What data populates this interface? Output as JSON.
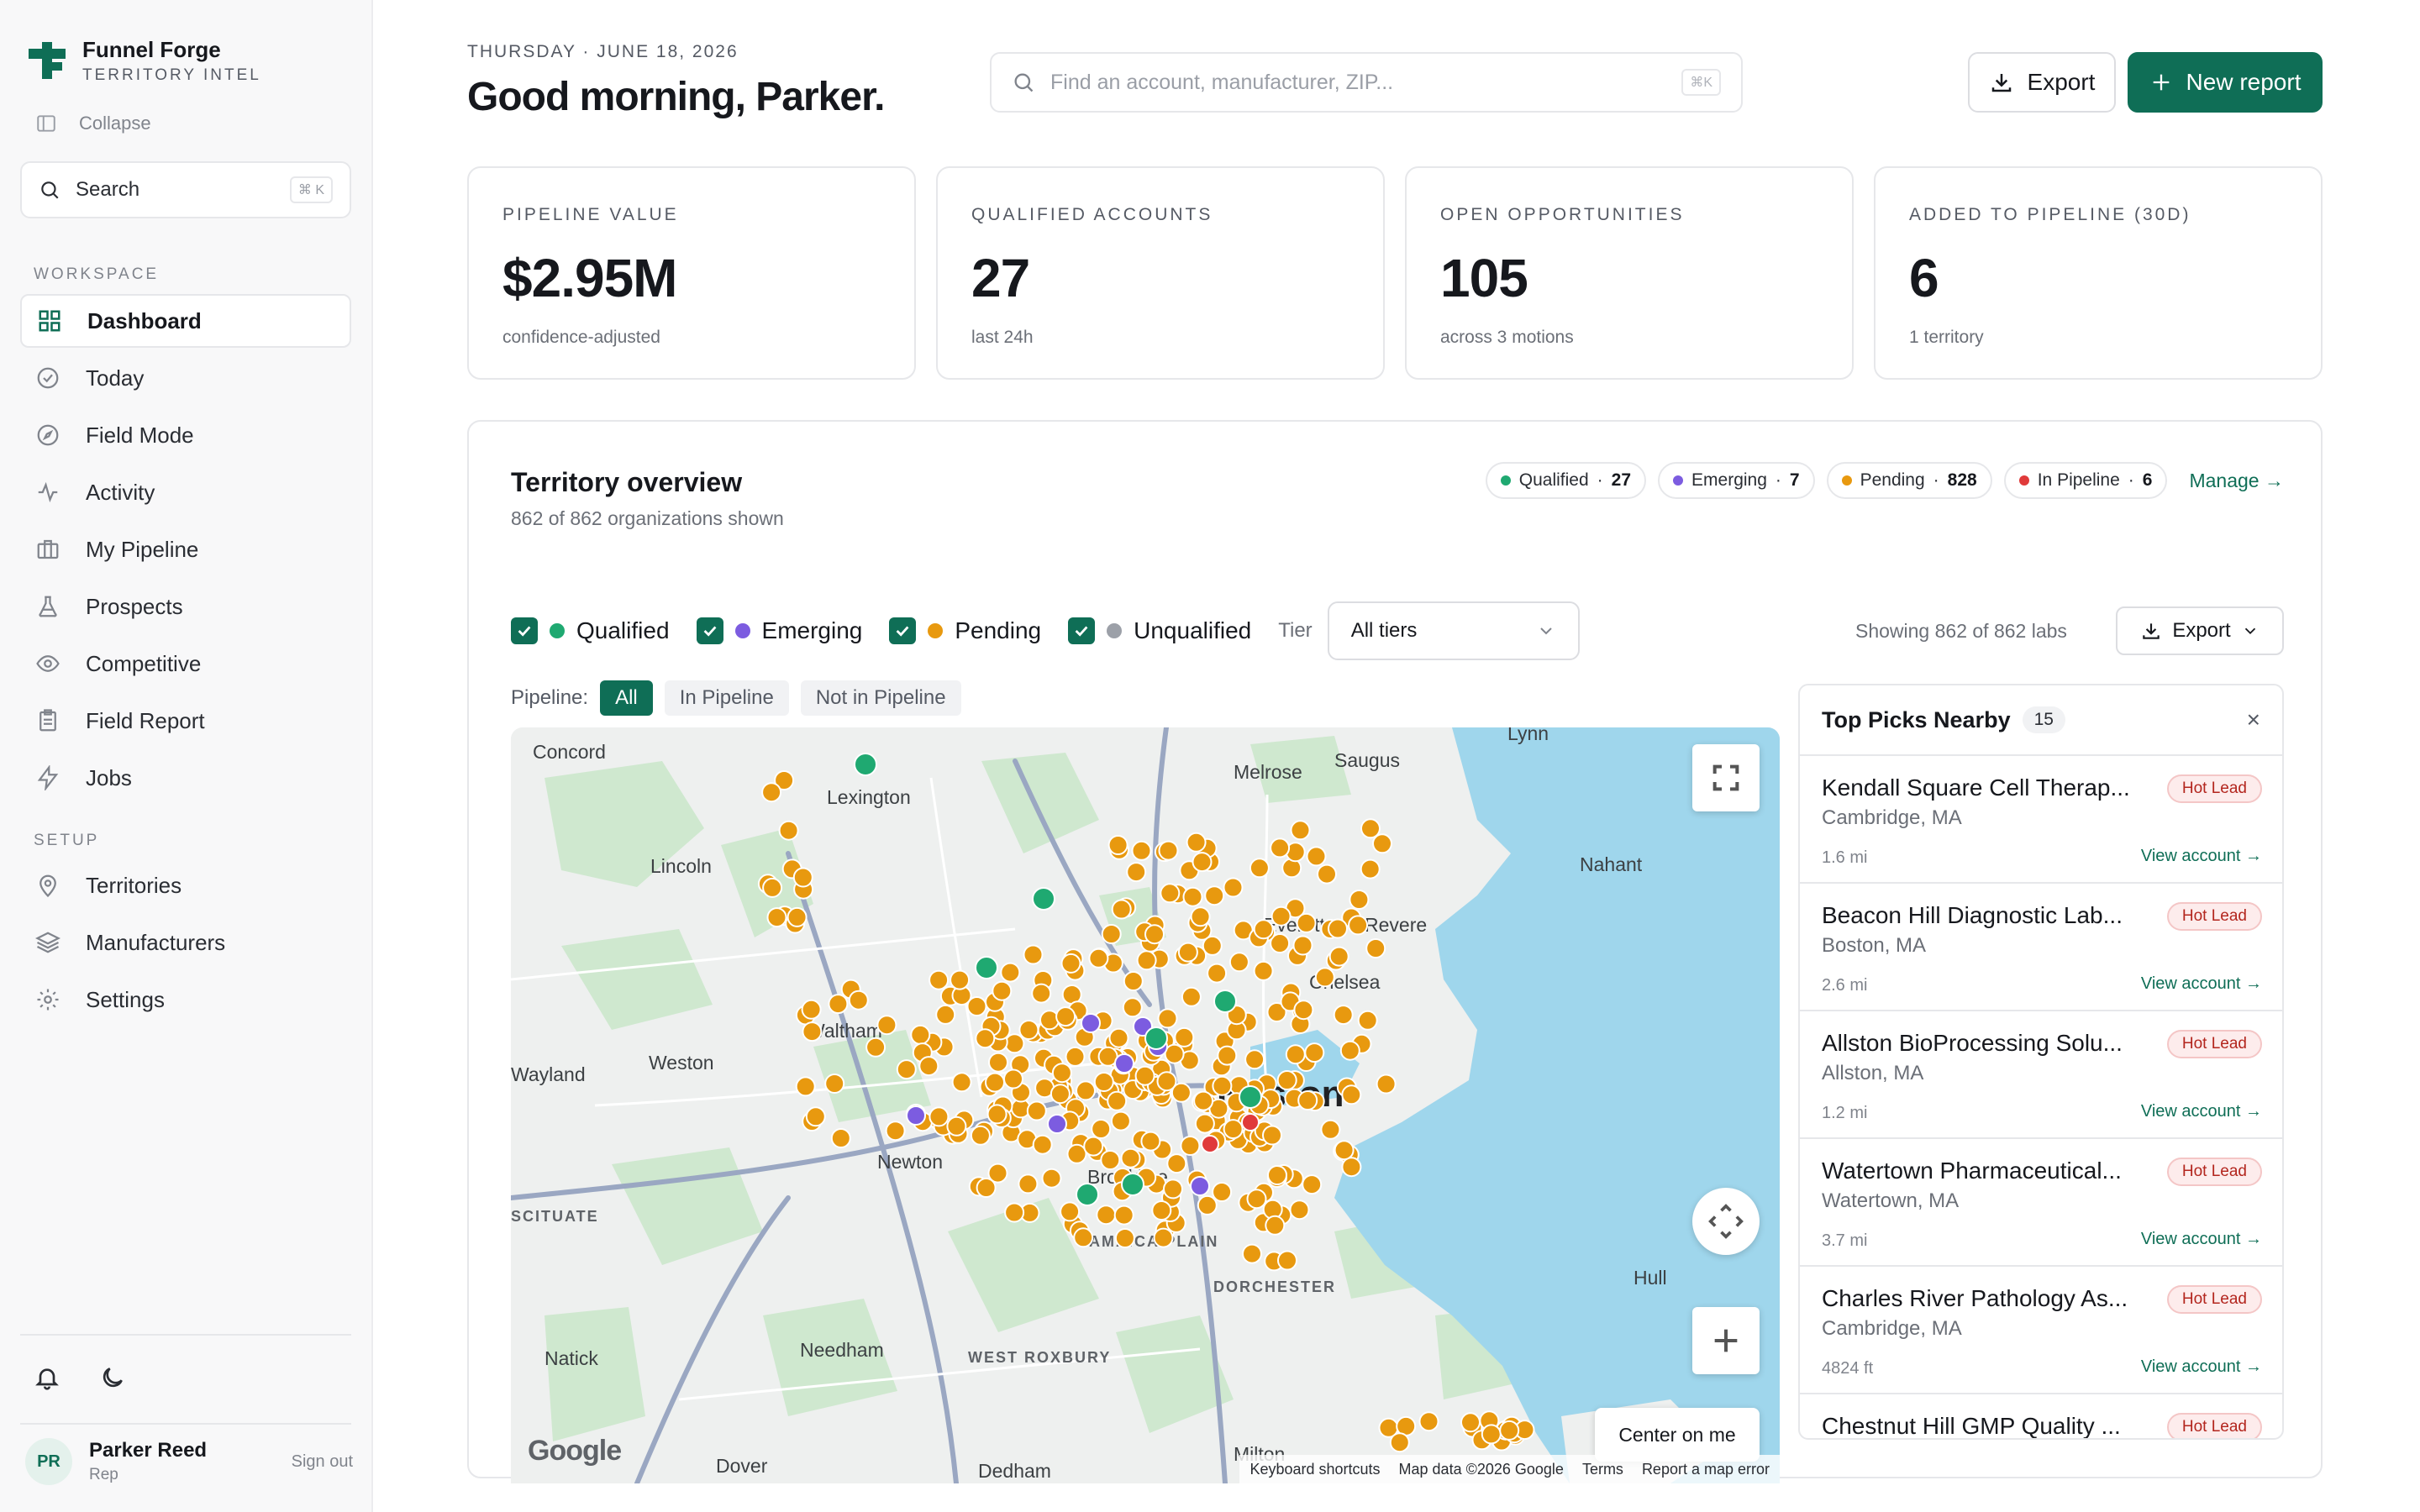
{
  "brand": {
    "name": "Funnel Forge",
    "subtitle": "TERRITORY INTEL",
    "collapse_label": "Collapse"
  },
  "sidebar": {
    "search_label": "Search",
    "search_shortcut": "⌘ K",
    "workspace_label": "WORKSPACE",
    "workspace_items": [
      {
        "label": "Dashboard",
        "icon": "grid-icon",
        "active": true
      },
      {
        "label": "Today",
        "icon": "check-circle-icon"
      },
      {
        "label": "Field Mode",
        "icon": "compass-icon"
      },
      {
        "label": "Activity",
        "icon": "pulse-icon"
      },
      {
        "label": "My Pipeline",
        "icon": "briefcase-icon"
      },
      {
        "label": "Prospects",
        "icon": "flask-icon"
      },
      {
        "label": "Competitive",
        "icon": "eye-icon"
      },
      {
        "label": "Field Report",
        "icon": "clipboard-icon"
      },
      {
        "label": "Jobs",
        "icon": "bolt-icon"
      }
    ],
    "setup_label": "SETUP",
    "setup_items": [
      {
        "label": "Territories",
        "icon": "map-pin-icon"
      },
      {
        "label": "Manufacturers",
        "icon": "layers-icon"
      },
      {
        "label": "Settings",
        "icon": "gear-icon"
      }
    ],
    "user": {
      "initials": "PR",
      "name": "Parker Reed",
      "role": "Rep",
      "signout": "Sign out"
    }
  },
  "header": {
    "date": "THURSDAY · JUNE 18, 2026",
    "greeting": "Good morning, Parker.",
    "search_placeholder": "Find an account, manufacturer, ZIP...",
    "search_shortcut": "⌘K",
    "export_label": "Export",
    "new_report_label": "New report"
  },
  "kpis": [
    {
      "label": "PIPELINE VALUE",
      "value": "$2.95M",
      "sub": "confidence-adjusted"
    },
    {
      "label": "QUALIFIED ACCOUNTS",
      "value": "27",
      "sub": "last 24h"
    },
    {
      "label": "OPEN OPPORTUNITIES",
      "value": "105",
      "sub": "across 3 motions"
    },
    {
      "label": "ADDED TO PIPELINE (30D)",
      "value": "6",
      "sub": "1 territory"
    }
  ],
  "territory": {
    "title": "Territory overview",
    "subtitle": "862 of 862 organizations shown",
    "chips": [
      {
        "label": "Qualified",
        "count": "27",
        "color": "#1fa971"
      },
      {
        "label": "Emerging",
        "count": "7",
        "color": "#7c5ce0"
      },
      {
        "label": "Pending",
        "count": "828",
        "color": "#e8990f"
      },
      {
        "label": "In Pipeline",
        "count": "6",
        "color": "#e03a3a"
      }
    ],
    "manage_label": "Manage →",
    "filters": [
      {
        "label": "Qualified",
        "color": "#1fa971"
      },
      {
        "label": "Emerging",
        "color": "#7c5ce0"
      },
      {
        "label": "Pending",
        "color": "#e8990f"
      },
      {
        "label": "Unqualified",
        "color": "#9ca0a8"
      }
    ],
    "tier_label": "Tier",
    "tier_value": "All tiers",
    "showing": "Showing 862 of 862 labs",
    "export_label": "Export",
    "pipeline_label": "Pipeline:",
    "pipeline_options": [
      "All",
      "In Pipeline",
      "Not in Pipeline"
    ],
    "pipeline_selected": "All"
  },
  "map": {
    "places": [
      "Concord",
      "Lexington",
      "Lincoln",
      "Melrose",
      "Saugus",
      "Nahant",
      "Everett",
      "Revere",
      "Chelsea",
      "Waltham",
      "Weston",
      "Wayland",
      "Boston",
      "Newton",
      "Brookline",
      "JAMAICA PLAIN",
      "DORCHESTER",
      "Needham",
      "WEST ROXBURY",
      "Natick",
      "Dover",
      "Dedham",
      "Milton",
      "Hull",
      "SCITUATE",
      "Lynn"
    ],
    "center_label": "Center on me",
    "google_label": "Google",
    "attribution": [
      "Keyboard shortcuts",
      "Map data ©2026 Google",
      "Terms",
      "Report a map error"
    ]
  },
  "top_picks": {
    "title": "Top Picks Nearby",
    "count": "15",
    "close": "×",
    "items": [
      {
        "name": "Kendall Square Cell Therap...",
        "location": "Cambridge, MA",
        "distance": "1.6 mi",
        "badge": "Hot Lead",
        "action": "View account →"
      },
      {
        "name": "Beacon Hill Diagnostic Lab...",
        "location": "Boston, MA",
        "distance": "2.6 mi",
        "badge": "Hot Lead",
        "action": "View account →"
      },
      {
        "name": "Allston BioProcessing Solu...",
        "location": "Allston, MA",
        "distance": "1.2 mi",
        "badge": "Hot Lead",
        "action": "View account →"
      },
      {
        "name": "Watertown Pharmaceutical...",
        "location": "Watertown, MA",
        "distance": "3.7 mi",
        "badge": "Hot Lead",
        "action": "View account →"
      },
      {
        "name": "Charles River Pathology As...",
        "location": "Cambridge, MA",
        "distance": "4824 ft",
        "badge": "Hot Lead",
        "action": "View account →"
      },
      {
        "name": "Chestnut Hill GMP Quality ...",
        "location": "",
        "distance": "",
        "badge": "Hot Lead",
        "action": ""
      }
    ]
  },
  "colors": {
    "accent": "#0f6e56",
    "qualified": "#1fa971",
    "emerging": "#7c5ce0",
    "pending": "#e8990f",
    "pipeline": "#e03a3a",
    "water": "#9fd6ec",
    "park": "#cfe8cf"
  }
}
